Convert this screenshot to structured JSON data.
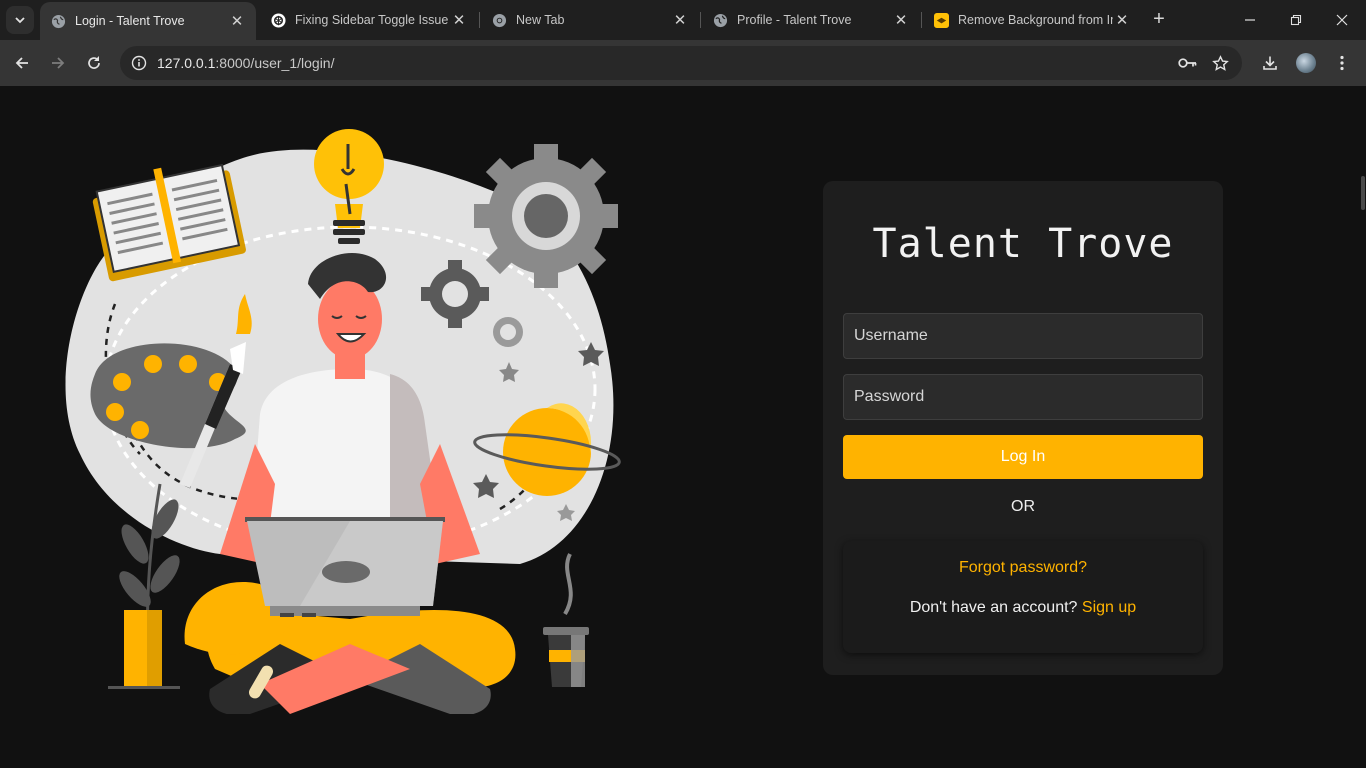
{
  "browser": {
    "tabs": [
      {
        "title": "Login - Talent Trove",
        "active": true,
        "favicon": "globe-icon"
      },
      {
        "title": "Fixing Sidebar Toggle Issue",
        "active": false,
        "favicon": "openai-icon"
      },
      {
        "title": "New Tab",
        "active": false,
        "favicon": "chrome-icon"
      },
      {
        "title": "Profile - Talent Trove",
        "active": false,
        "favicon": "globe-icon"
      },
      {
        "title": "Remove Background from Im",
        "active": false,
        "favicon": "removebg-icon"
      }
    ],
    "url_host": "127.0.0.1",
    "url_rest": ":8000/user_1/login/",
    "accent": "#ffb300"
  },
  "login": {
    "brand": "Talent Trove",
    "username_placeholder": "Username",
    "password_placeholder": "Password",
    "login_label": "Log In",
    "or_label": "OR",
    "forgot_label": "Forgot password?",
    "no_account_text": "Don't have an account?",
    "signup_label": "Sign up"
  }
}
